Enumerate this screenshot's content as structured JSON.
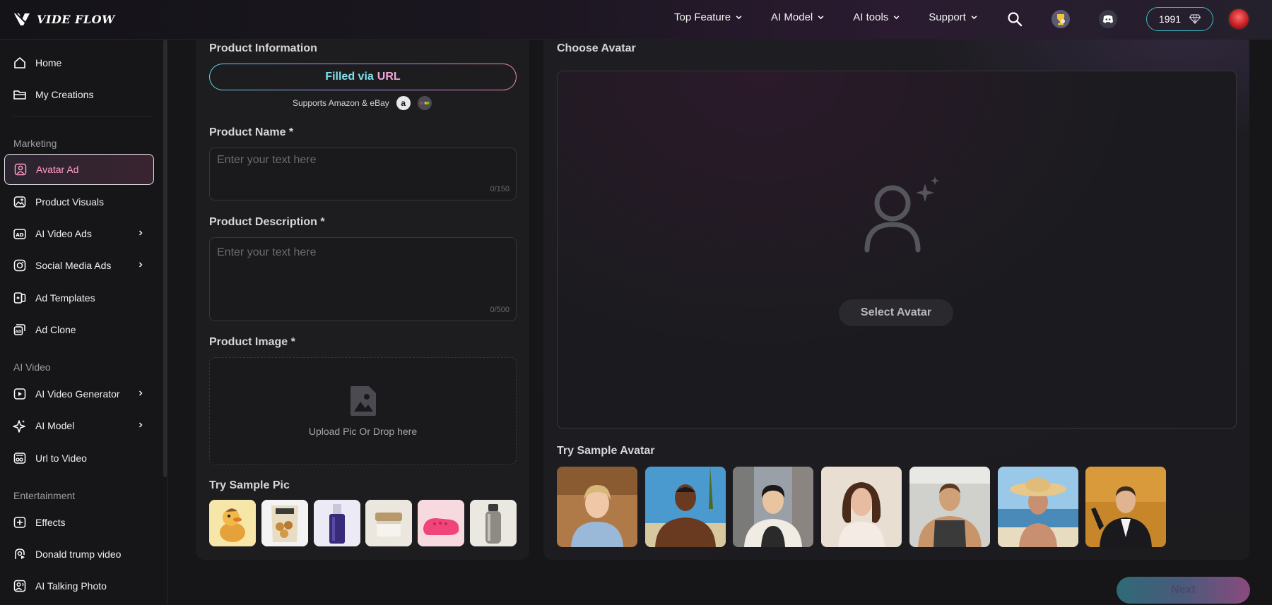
{
  "app": {
    "logo_text": "VIDE FLOW"
  },
  "topnav": {
    "items": [
      {
        "label": "Top Feature"
      },
      {
        "label": "AI Model"
      },
      {
        "label": "AI tools"
      },
      {
        "label": "Support"
      }
    ],
    "credits": "1991",
    "icons": [
      "search-icon",
      "trophy-icon",
      "discord-icon",
      "diamond-icon"
    ]
  },
  "sidebar": {
    "top_items": [
      {
        "label": "Home",
        "icon": "home-icon"
      },
      {
        "label": "My Creations",
        "icon": "folder-icon"
      }
    ],
    "sections": [
      {
        "title": "Marketing",
        "items": [
          {
            "label": "Avatar Ad",
            "icon": "avatar-icon",
            "active": true
          },
          {
            "label": "Product Visuals",
            "icon": "image-sparkle-icon"
          },
          {
            "label": "AI Video Ads",
            "icon": "ad-icon",
            "has_submenu": true
          },
          {
            "label": "Social Media Ads",
            "icon": "social-icon",
            "has_submenu": true
          },
          {
            "label": "Ad Templates",
            "icon": "template-icon"
          },
          {
            "label": "Ad Clone",
            "icon": "clone-icon"
          }
        ]
      },
      {
        "title": "AI Video",
        "items": [
          {
            "label": "AI Video Generator",
            "icon": "video-play-icon",
            "has_submenu": true
          },
          {
            "label": "AI Model",
            "icon": "sparkle-icon",
            "has_submenu": true
          },
          {
            "label": "Url to Video",
            "icon": "link-video-icon"
          }
        ]
      },
      {
        "title": "Entertainment",
        "items": [
          {
            "label": "Effects",
            "icon": "effects-icon"
          },
          {
            "label": "Donald trump video",
            "icon": "face-icon"
          },
          {
            "label": "AI Talking Photo",
            "icon": "talking-photo-icon"
          }
        ]
      }
    ]
  },
  "form": {
    "product_info_label": "Product Information",
    "url_button": {
      "prefix": "Filled via",
      "highlight": "URL"
    },
    "supports_text": "Supports Amazon & eBay",
    "product_name": {
      "label": "Product Name *",
      "placeholder": "Enter your text here",
      "value": "",
      "counter": "0/150"
    },
    "product_description": {
      "label": "Product Description *",
      "placeholder": "Enter your text here",
      "value": "",
      "counter": "0/500"
    },
    "product_image": {
      "label": "Product Image *",
      "upload_text": "Upload Pic Or Drop here"
    },
    "sample_pic_label": "Try Sample Pic",
    "sample_pics": [
      {
        "name": "duck-figurine"
      },
      {
        "name": "snack-bag"
      },
      {
        "name": "serum-bottle"
      },
      {
        "name": "cream-jar"
      },
      {
        "name": "pink-clog"
      },
      {
        "name": "steel-bottle"
      }
    ]
  },
  "avatar": {
    "choose_label": "Choose Avatar",
    "select_button": "Select Avatar",
    "sample_label": "Try Sample Avatar",
    "samples": [
      {
        "name": "woman-kitchen"
      },
      {
        "name": "man-beach"
      },
      {
        "name": "man-street"
      },
      {
        "name": "woman-portrait"
      },
      {
        "name": "man-gym"
      },
      {
        "name": "woman-sunhat"
      },
      {
        "name": "man-suit"
      }
    ]
  },
  "footer": {
    "next_button": "Next"
  },
  "colors": {
    "accent_cyan": "#5fd8e8",
    "accent_pink": "#f3a6d6",
    "active_text": "#ff9fc2",
    "credit_border": "#3fb8c8"
  }
}
